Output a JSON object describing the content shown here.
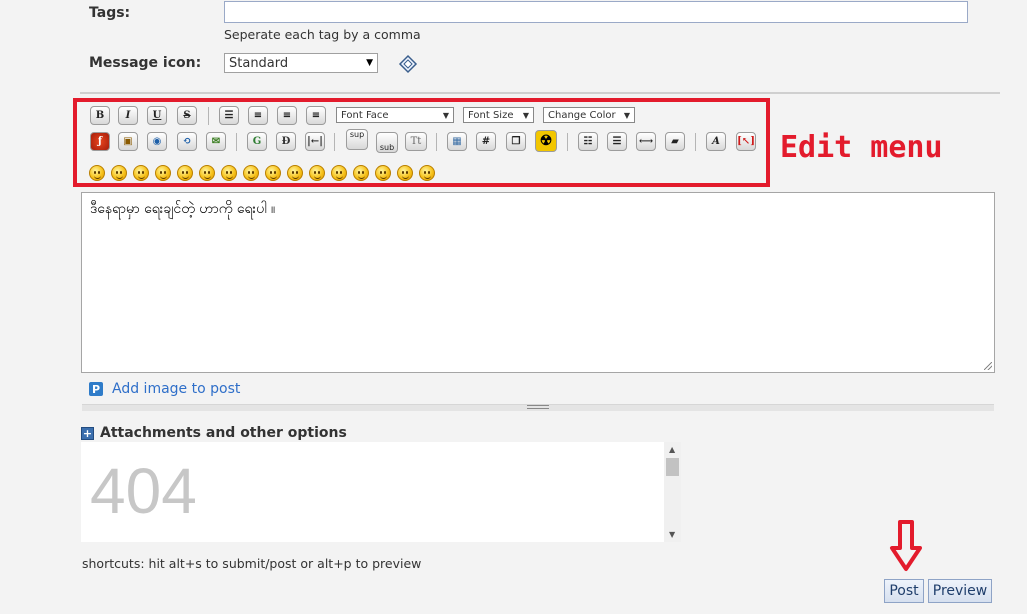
{
  "tags": {
    "label": "Tags:",
    "value": "",
    "hint": "Seperate each tag by a comma"
  },
  "message_icon": {
    "label": "Message icon:",
    "selected": "Standard"
  },
  "toolbar": {
    "font_face": "Font Face",
    "font_size": "Font Size",
    "change_color": "Change Color",
    "bold": "B",
    "italic": "I",
    "underline": "U",
    "strike": "S",
    "google": "G",
    "tc": "Tt",
    "sup": "sup",
    "sub": "sub",
    "hash": "#"
  },
  "annotation": {
    "edit_menu": "Edit menu"
  },
  "editor": {
    "content": "ဒီနေရာမှာ ရေးချင်တဲ့ ဟာကို ရေးပါ ။"
  },
  "add_image": {
    "label": "Add image to post"
  },
  "attachments": {
    "title": "Attachments and other options",
    "frame_text": "404"
  },
  "shortcuts": {
    "text": "shortcuts: hit alt+s to submit/post or alt+p to preview"
  },
  "buttons": {
    "post": "Post",
    "preview": "Preview"
  },
  "colors": {
    "annotation_red": "#e31b2c",
    "link_blue": "#2f6fc9"
  }
}
